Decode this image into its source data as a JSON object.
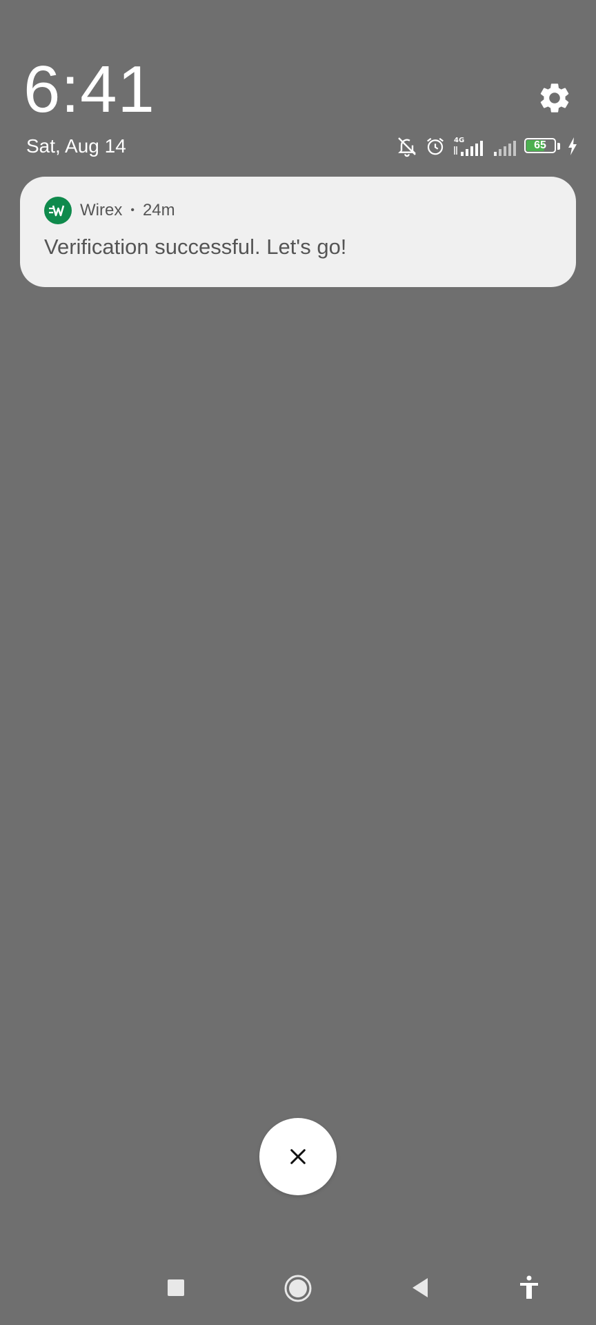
{
  "lockscreen": {
    "time": "6:41",
    "date": "Sat, Aug 14"
  },
  "status_bar": {
    "network_type": "4G",
    "battery_percent": "65",
    "battery_level": 0.65,
    "icons": [
      "notifications-off-icon",
      "alarm-icon",
      "signal-4g-icon",
      "signal-weak-icon",
      "battery-icon",
      "charging-icon"
    ]
  },
  "notification": {
    "app_name": "Wirex",
    "separator": "•",
    "time_ago": "24m",
    "message": "Verification successful. Let's go!",
    "app_icon_color": "#0f8a4c"
  },
  "controls": {
    "dismiss_icon": "close-icon",
    "settings_icon": "gear-icon"
  },
  "nav_bar": {
    "buttons": [
      "recents-icon",
      "home-icon",
      "back-icon",
      "accessibility-icon"
    ]
  },
  "colors": {
    "background": "#6f6f6f",
    "card": "#f0f0f0",
    "accent_green": "#4caf50"
  }
}
